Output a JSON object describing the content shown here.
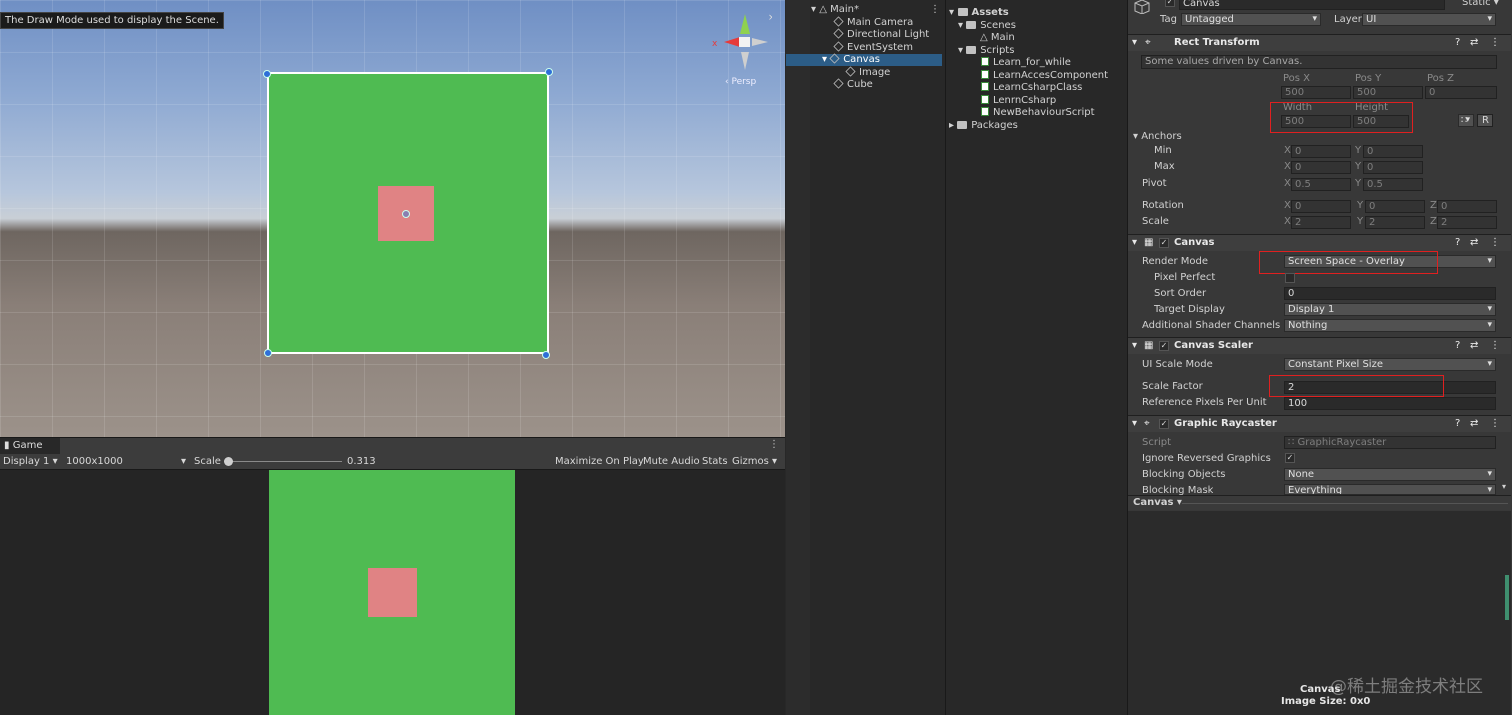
{
  "scene": {
    "tooltip": "The Draw Mode used to display the Scene.",
    "persp": "‹ Persp"
  },
  "game": {
    "tab": "Game",
    "display": "Display 1",
    "resolution": "1000x1000",
    "scale_label": "Scale",
    "scale_value": "0.313",
    "maximize": "Maximize On Play",
    "mute": "Mute Audio",
    "stats": "Stats",
    "gizmos": "Gizmos"
  },
  "hierarchy": {
    "scene": "Main*",
    "items": [
      "Main Camera",
      "Directional Light",
      "EventSystem",
      "Canvas",
      "Image",
      "Cube"
    ]
  },
  "project": {
    "assets": "Assets",
    "scenes": "Scenes",
    "main": "Main",
    "scripts": "Scripts",
    "files": [
      "Learn_for_while",
      "LearnAccesComponent",
      "LearnCsharpClass",
      "LenrnCsharp",
      "NewBehaviourScript"
    ],
    "packages": "Packages"
  },
  "inspector": {
    "object_name": "Canvas",
    "static": "Static",
    "tag_label": "Tag",
    "tag": "Untagged",
    "layer_label": "Layer",
    "layer": "UI",
    "rect": {
      "title": "Rect Transform",
      "info": "Some values driven by Canvas.",
      "pos_x_label": "Pos X",
      "pos_y_label": "Pos Y",
      "pos_z_label": "Pos Z",
      "pos_x": "500",
      "pos_y": "500",
      "pos_z": "0",
      "width_label": "Width",
      "height_label": "Height",
      "width": "500",
      "height": "500",
      "r_button": "R",
      "anchors": "Anchors",
      "min": "Min",
      "max": "Max",
      "min_x": "0",
      "min_y": "0",
      "max_x": "0",
      "max_y": "0",
      "pivot": "Pivot",
      "pivot_x": "0.5",
      "pivot_y": "0.5",
      "rotation": "Rotation",
      "rot_x": "0",
      "rot_y": "0",
      "rot_z": "0",
      "scale": "Scale",
      "scale_x": "2",
      "scale_y": "2",
      "scale_z": "2",
      "x": "X",
      "y": "Y",
      "z": "Z"
    },
    "canvas": {
      "title": "Canvas",
      "render_mode_label": "Render Mode",
      "render_mode": "Screen Space - Overlay",
      "pixel_perfect": "Pixel Perfect",
      "sort_order_label": "Sort Order",
      "sort_order": "0",
      "target_display_label": "Target Display",
      "target_display": "Display 1",
      "shader_channels_label": "Additional Shader Channels",
      "shader_channels": "Nothing"
    },
    "scaler": {
      "title": "Canvas Scaler",
      "mode_label": "UI Scale Mode",
      "mode": "Constant Pixel Size",
      "factor_label": "Scale Factor",
      "factor": "2",
      "ref_label": "Reference Pixels Per Unit",
      "ref": "100"
    },
    "raycaster": {
      "title": "Graphic Raycaster",
      "script_label": "Script",
      "script": "GraphicRaycaster",
      "ignore_label": "Ignore Reversed Graphics",
      "blocking_label": "Blocking Objects",
      "blocking": "None",
      "mask_label": "Blocking Mask",
      "mask": "Everything"
    },
    "preview": {
      "dropdown": "Canvas",
      "name": "Canvas",
      "size": "Image Size: 0x0"
    },
    "watermark": "@稀土掘金技术社区"
  }
}
